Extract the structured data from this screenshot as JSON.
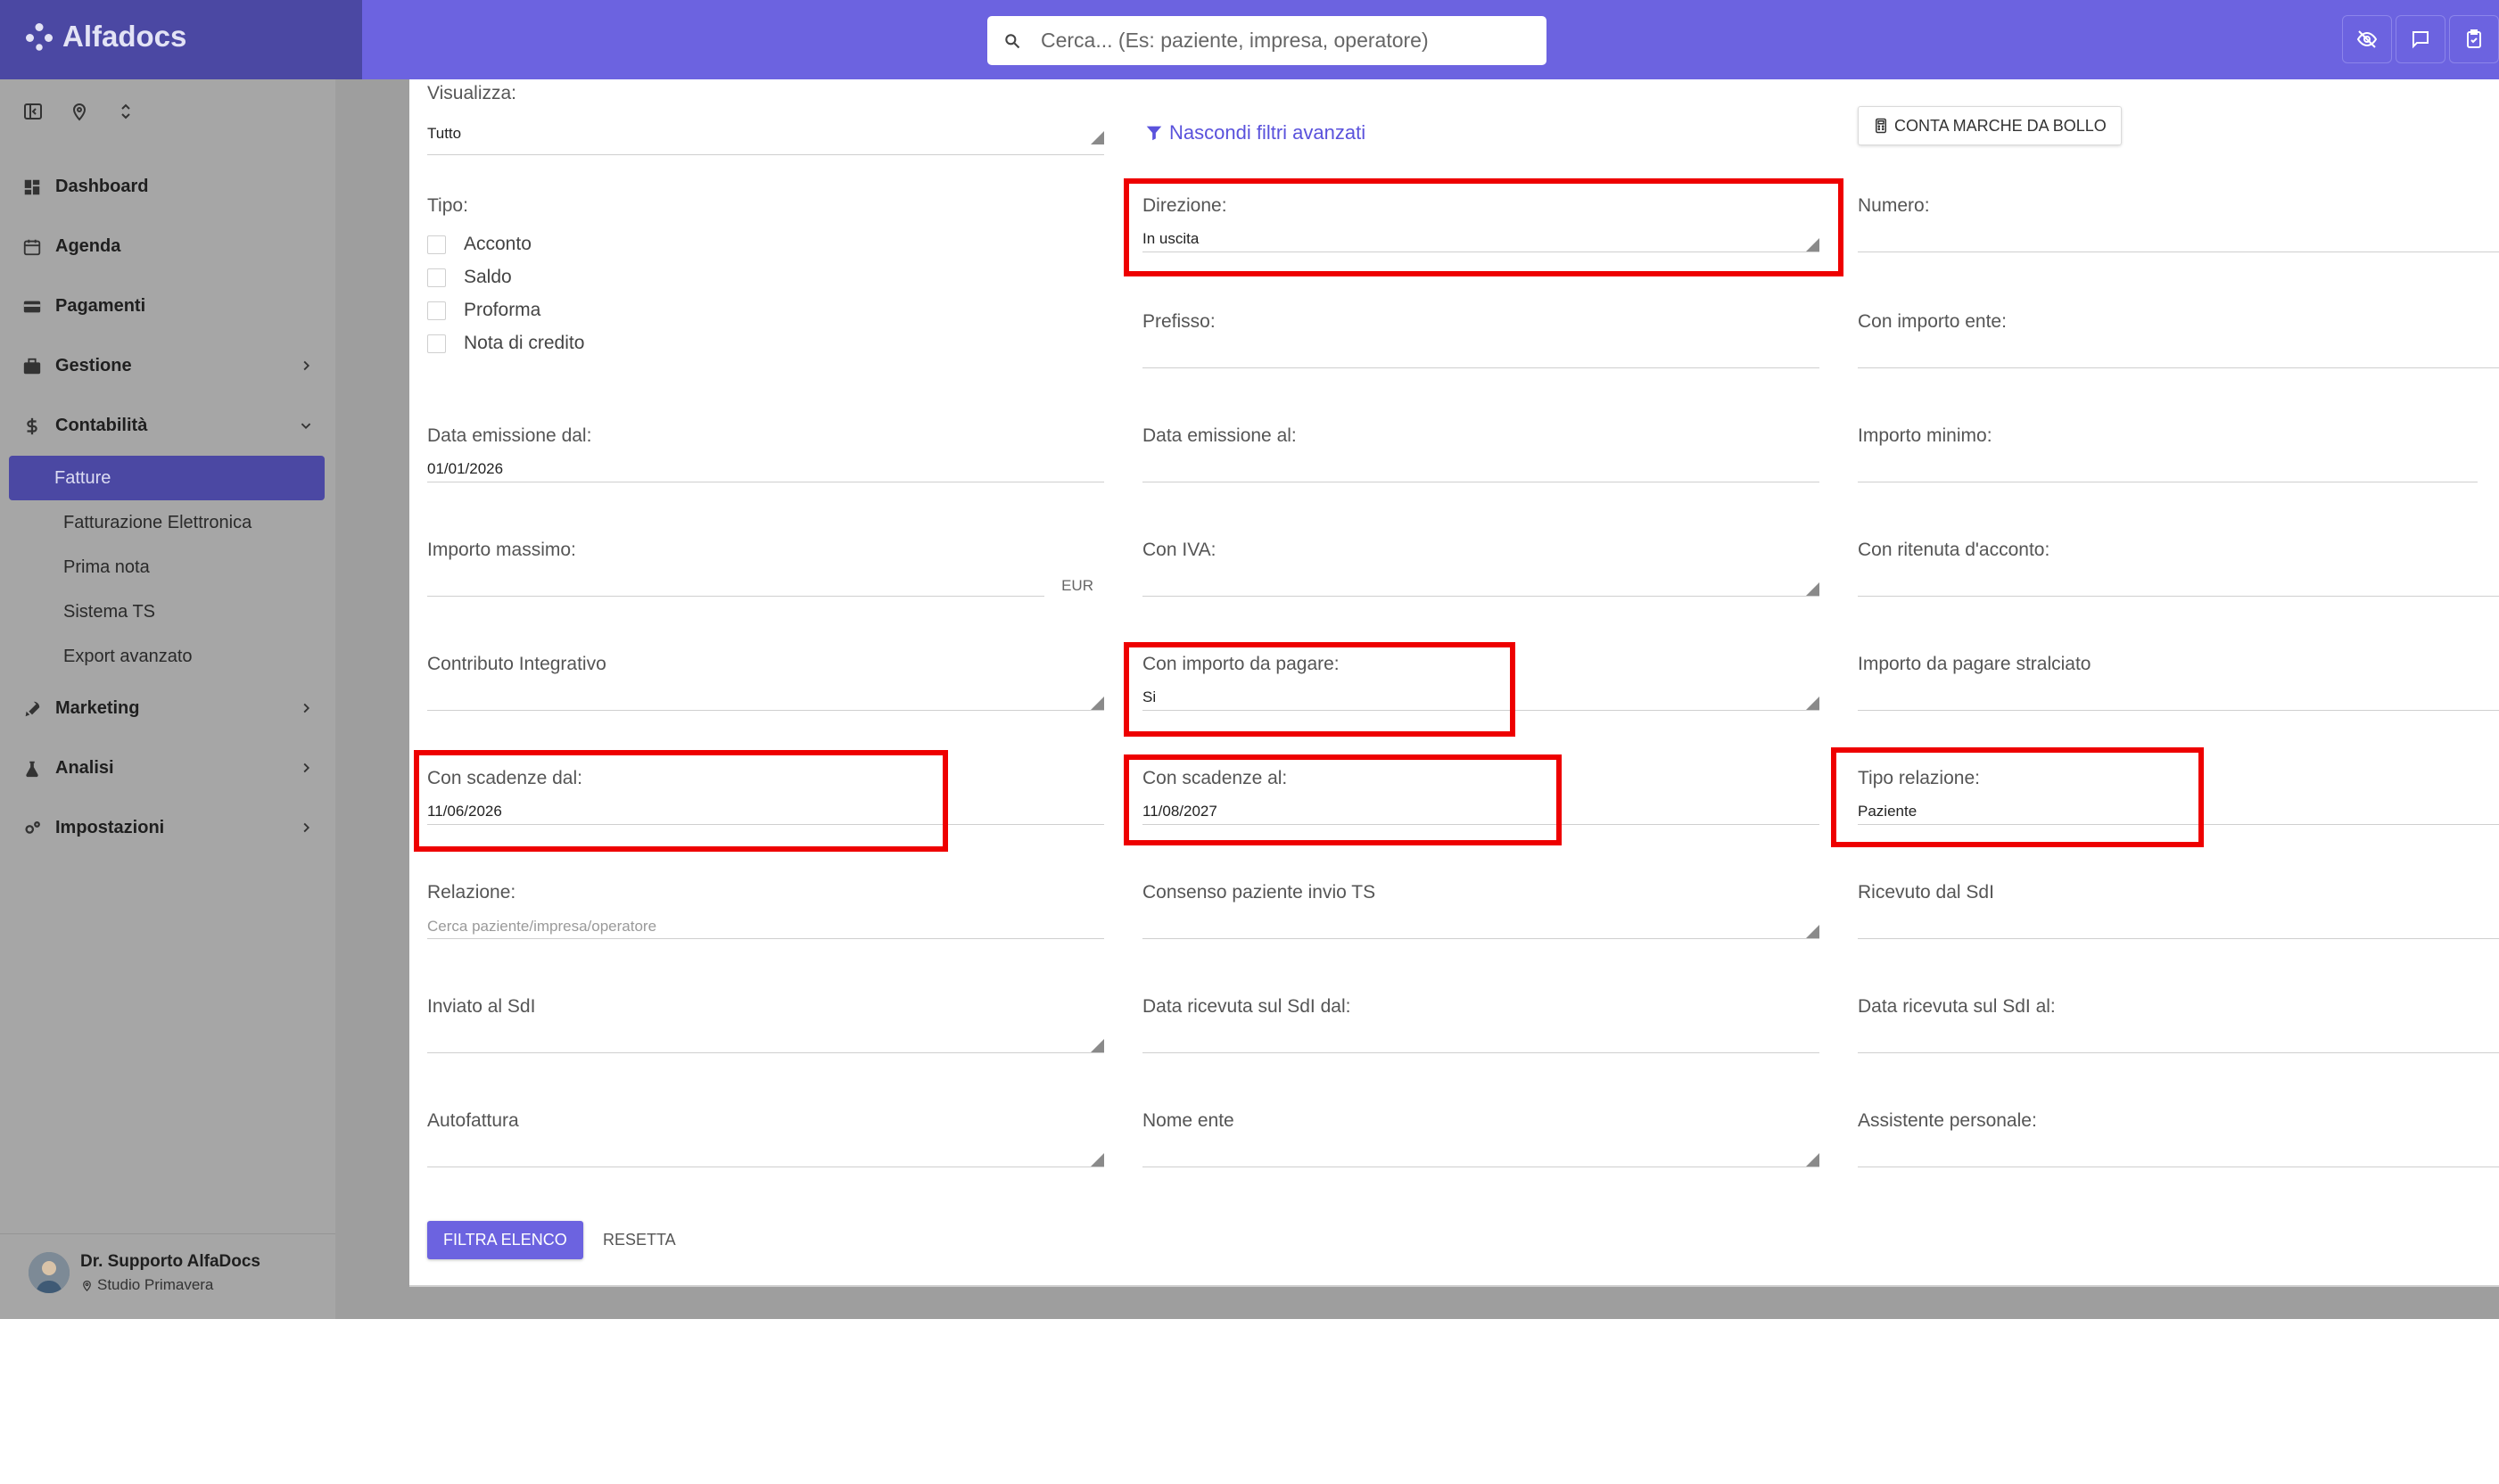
{
  "app": {
    "brand": "Alfadocs"
  },
  "search": {
    "placeholder": "Cerca... (Es: paziente, impresa, operatore)"
  },
  "nav": {
    "items": [
      {
        "label": "Dashboard"
      },
      {
        "label": "Agenda"
      },
      {
        "label": "Pagamenti"
      },
      {
        "label": "Gestione"
      },
      {
        "label": "Contabilità"
      }
    ],
    "contabilita_sub": [
      "Fatture",
      "Fatturazione Elettronica",
      "Prima nota",
      "Sistema TS",
      "Export avanzato"
    ],
    "items_after": [
      {
        "label": "Marketing"
      },
      {
        "label": "Analisi"
      },
      {
        "label": "Impostazioni"
      }
    ]
  },
  "user": {
    "name": "Dr. Supporto AlfaDocs",
    "studio": "Studio Primavera"
  },
  "toolbar": {
    "advanced_filters": "Nascondi filtri avanzati",
    "bollo_button": "CONTA MARCHE DA BOLLO"
  },
  "filters": {
    "visualizza": {
      "label": "Visualizza:",
      "value": "Tutto"
    },
    "tipo": {
      "label": "Tipo:",
      "options": [
        "Acconto",
        "Saldo",
        "Proforma",
        "Nota di credito"
      ]
    },
    "direzione": {
      "label": "Direzione:",
      "value": "In uscita"
    },
    "numero": {
      "label": "Numero:"
    },
    "prefisso": {
      "label": "Prefisso:"
    },
    "con_importo_ente": {
      "label": "Con importo ente:"
    },
    "data_emissione_dal": {
      "label": "Data emissione dal:",
      "value": "01/01/2026"
    },
    "data_emissione_al": {
      "label": "Data emissione al:"
    },
    "importo_minimo": {
      "label": "Importo minimo:"
    },
    "importo_massimo": {
      "label": "Importo massimo:",
      "unit": "EUR"
    },
    "con_iva": {
      "label": "Con IVA:"
    },
    "con_ritenuta": {
      "label": "Con ritenuta d'acconto:"
    },
    "contributo_integrativo": {
      "label": "Contributo Integrativo"
    },
    "con_importo_da_pagare": {
      "label": "Con importo da pagare:",
      "value": "Si"
    },
    "importo_stralciato": {
      "label": "Importo da pagare stralciato"
    },
    "scadenze_dal": {
      "label": "Con scadenze dal:",
      "value": "11/06/2026"
    },
    "scadenze_al": {
      "label": "Con scadenze al:",
      "value": "11/08/2027"
    },
    "tipo_relazione": {
      "label": "Tipo relazione:",
      "value": "Paziente"
    },
    "relazione": {
      "label": "Relazione:",
      "placeholder": "Cerca paziente/impresa/operatore"
    },
    "consenso_ts": {
      "label": "Consenso paziente invio TS"
    },
    "ricevuto_sdi": {
      "label": "Ricevuto dal SdI"
    },
    "inviato_sdi": {
      "label": "Inviato al SdI"
    },
    "data_ricevuta_dal": {
      "label": "Data ricevuta sul SdI dal:"
    },
    "data_ricevuta_al": {
      "label": "Data ricevuta sul SdI al:"
    },
    "autofattura": {
      "label": "Autofattura"
    },
    "nome_ente": {
      "label": "Nome ente"
    },
    "assistente_personale": {
      "label": "Assistente personale:"
    }
  },
  "actions": {
    "filter": "FILTRA ELENCO",
    "reset": "RESETTA"
  },
  "colors": {
    "sidebar_head": "#4b48a3",
    "topbar": "#6c63e0",
    "accent": "#5a52dc",
    "highlight": "#ee0000"
  }
}
